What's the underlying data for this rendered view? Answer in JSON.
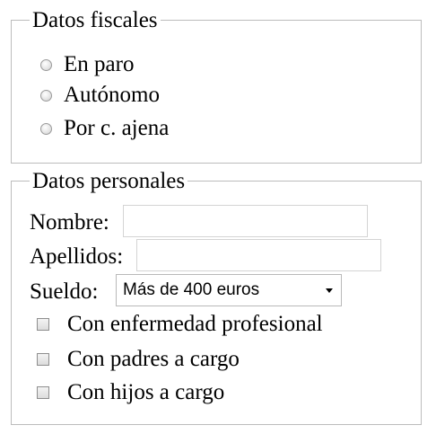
{
  "fiscal": {
    "legend": "Datos fiscales",
    "options": [
      {
        "label": "En paro",
        "checked": false
      },
      {
        "label": "Autónomo",
        "checked": false
      },
      {
        "label": "Por c. ajena",
        "checked": false
      }
    ]
  },
  "personal": {
    "legend": "Datos personales",
    "nombre_label": "Nombre:",
    "nombre_value": "",
    "apellidos_label": "Apellidos:",
    "apellidos_value": "",
    "sueldo_label": "Sueldo:",
    "sueldo_selected": "Más de 400 euros",
    "checkboxes": [
      {
        "label": "Con enfermedad profesional",
        "checked": false
      },
      {
        "label": "Con padres a cargo",
        "checked": false
      },
      {
        "label": "Con hijos a cargo",
        "checked": false
      }
    ]
  }
}
